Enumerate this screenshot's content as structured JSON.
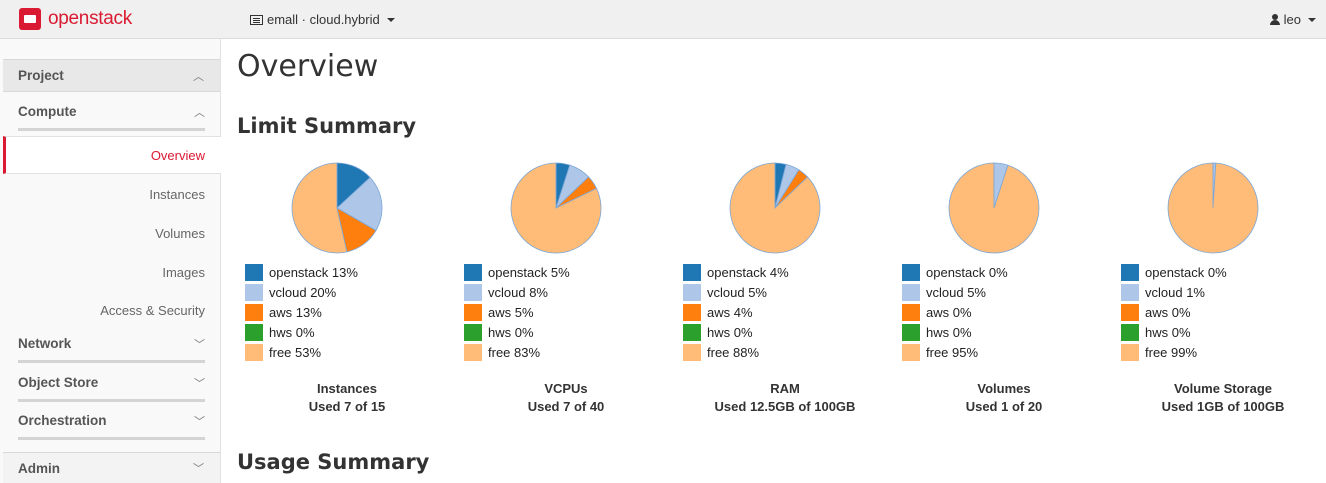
{
  "brand": {
    "name": "openstack"
  },
  "context": {
    "label": "emall · cloud.hybrid"
  },
  "user": {
    "name": "leo"
  },
  "sidebar": {
    "project": "Project",
    "compute": "Compute",
    "compute_items": [
      "Overview",
      "Instances",
      "Volumes",
      "Images",
      "Access & Security"
    ],
    "network": "Network",
    "object_store": "Object Store",
    "orchestration": "Orchestration",
    "admin": "Admin"
  },
  "main": {
    "title": "Overview",
    "limit_summary": "Limit Summary",
    "usage_summary": "Usage Summary"
  },
  "colors": {
    "openstack": "#1f77b4",
    "vcloud": "#aec7e8",
    "aws": "#ff7f0e",
    "hws": "#2ca02c",
    "free": "#ffbb78"
  },
  "chart_data": [
    {
      "type": "pie",
      "title": "Instances",
      "subtitle": "Used 7 of 15",
      "slices": [
        {
          "name": "openstack",
          "value": 13,
          "label": "openstack 13%"
        },
        {
          "name": "vcloud",
          "value": 20,
          "label": "vcloud 20%"
        },
        {
          "name": "aws",
          "value": 13,
          "label": "aws 13%"
        },
        {
          "name": "hws",
          "value": 0,
          "label": "hws 0%"
        },
        {
          "name": "free",
          "value": 53,
          "label": "free 53%"
        }
      ]
    },
    {
      "type": "pie",
      "title": "VCPUs",
      "subtitle": "Used 7 of 40",
      "slices": [
        {
          "name": "openstack",
          "value": 5,
          "label": "openstack 5%"
        },
        {
          "name": "vcloud",
          "value": 8,
          "label": "vcloud 8%"
        },
        {
          "name": "aws",
          "value": 5,
          "label": "aws 5%"
        },
        {
          "name": "hws",
          "value": 0,
          "label": "hws 0%"
        },
        {
          "name": "free",
          "value": 83,
          "label": "free 83%"
        }
      ]
    },
    {
      "type": "pie",
      "title": "RAM",
      "subtitle": "Used 12.5GB of 100GB",
      "slices": [
        {
          "name": "openstack",
          "value": 4,
          "label": "openstack 4%"
        },
        {
          "name": "vcloud",
          "value": 5,
          "label": "vcloud 5%"
        },
        {
          "name": "aws",
          "value": 4,
          "label": "aws 4%"
        },
        {
          "name": "hws",
          "value": 0,
          "label": "hws 0%"
        },
        {
          "name": "free",
          "value": 88,
          "label": "free 88%"
        }
      ]
    },
    {
      "type": "pie",
      "title": "Volumes",
      "subtitle": "Used 1 of 20",
      "slices": [
        {
          "name": "openstack",
          "value": 0,
          "label": "openstack 0%"
        },
        {
          "name": "vcloud",
          "value": 5,
          "label": "vcloud 5%"
        },
        {
          "name": "aws",
          "value": 0,
          "label": "aws 0%"
        },
        {
          "name": "hws",
          "value": 0,
          "label": "hws 0%"
        },
        {
          "name": "free",
          "value": 95,
          "label": "free 95%"
        }
      ]
    },
    {
      "type": "pie",
      "title": "Volume Storage",
      "subtitle": "Used 1GB of 100GB",
      "slices": [
        {
          "name": "openstack",
          "value": 0,
          "label": "openstack 0%"
        },
        {
          "name": "vcloud",
          "value": 1,
          "label": "vcloud 1%"
        },
        {
          "name": "aws",
          "value": 0,
          "label": "aws 0%"
        },
        {
          "name": "hws",
          "value": 0,
          "label": "hws 0%"
        },
        {
          "name": "free",
          "value": 99,
          "label": "free 99%"
        }
      ]
    }
  ]
}
